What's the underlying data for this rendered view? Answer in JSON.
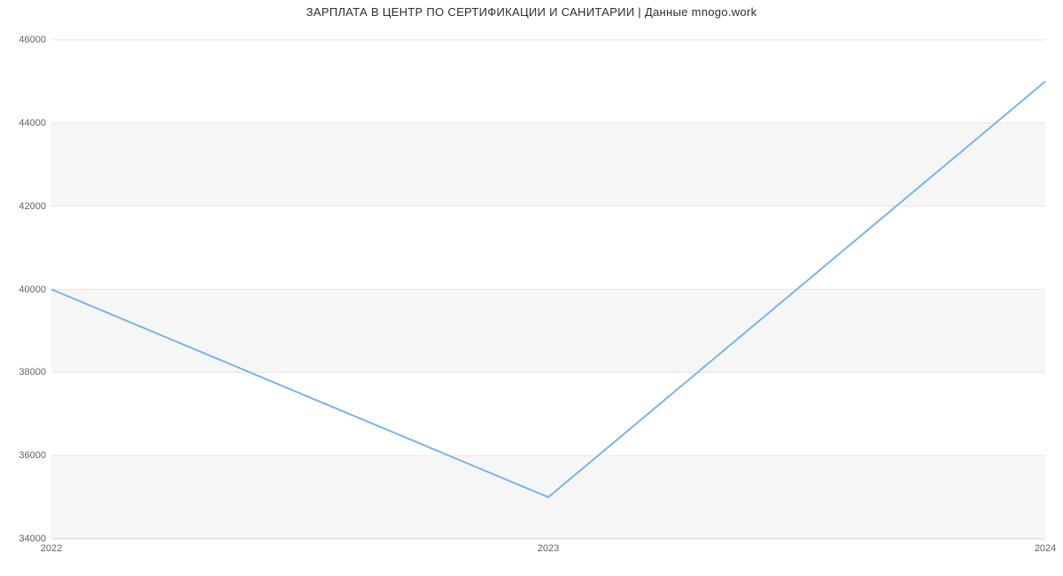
{
  "title": "ЗАРПЛАТА В  ЦЕНТР ПО СЕРТИФИКАЦИИ И САНИТАРИИ | Данные mnogo.work",
  "y_ticks": [
    "34000",
    "36000",
    "38000",
    "40000",
    "42000",
    "44000",
    "46000"
  ],
  "x_ticks": [
    "2022",
    "2023",
    "2024"
  ],
  "chart_data": {
    "type": "line",
    "title": "ЗАРПЛАТА В  ЦЕНТР ПО СЕРТИФИКАЦИИ И САНИТАРИИ | Данные mnogo.work",
    "xlabel": "",
    "ylabel": "",
    "x": [
      "2022",
      "2023",
      "2024"
    ],
    "values": [
      40000,
      35000,
      45000
    ],
    "xlim": [
      "2022",
      "2024"
    ],
    "ylim": [
      34000,
      46000
    ],
    "x_ticks": [
      "2022",
      "2023",
      "2024"
    ],
    "y_ticks": [
      34000,
      36000,
      38000,
      40000,
      42000,
      44000,
      46000
    ],
    "grid": true,
    "legend": false,
    "line_color": "#7cb5ec"
  }
}
